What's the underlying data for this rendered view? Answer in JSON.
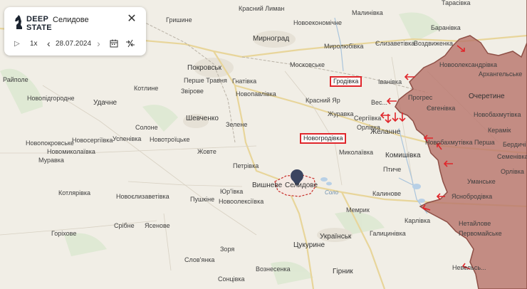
{
  "panel": {
    "logo_line1": "DEEP",
    "logo_line2": "STATE",
    "title": "Селидове",
    "close": "✕",
    "play": "▷",
    "speed": "1x",
    "prev": "‹",
    "date": "28.07.2024",
    "next": "›",
    "calendar_icon": "calendar-icon",
    "compare_icon": "compare-icon"
  },
  "colors": {
    "occupied": "#b8766d",
    "occupied_border": "#8e4f46",
    "arrow": "#e0262b",
    "highlight": "#e0262b",
    "marker": "#3b4560"
  },
  "places": {
    "krasnyi_lyman": "Красний Лиман",
    "malynivka": "Малинівка",
    "tarasivka": "Тарасівка",
    "hryshyne": "Гришине",
    "myrnohrad": "Мирноград",
    "novoekonomichne": "Новоекономічне",
    "baranivka": "Баранівка",
    "myrolyubivka": "Миролюбівка",
    "yelyzavetivka": "Єлизаветівка",
    "vozdvyzhenka": "Воздвиженка",
    "pokrovsk": "Покровськ",
    "moskovske": "Московське",
    "novooleksandrivka": "Новоолександрівка",
    "raipole": "Райполе",
    "pershe_travnia": "Перше Травня",
    "hnativka": "Гнатівка",
    "hrodivka": "Гродівка",
    "ivanivka": "Іванівка",
    "arkhanhelske": "Архангельське",
    "novopidhorodne": "Новопідгородне",
    "kotlyne": "Котлине",
    "zvirove": "Звірове",
    "novopavlivka": "Новопавлівка",
    "prohres": "Прогрес",
    "ocheretyne": "Очеретине",
    "udachne": "Удачне",
    "krasnyi_yar": "Красний Яр",
    "veselyi": "Вес...",
    "yevhenivka": "Євгенівка",
    "shevchenko": "Шевченко",
    "zhuravka": "Журавка",
    "serhiivka": "Сергіївка",
    "novobakhmutivka": "Новобахмутівка",
    "solone": "Солоне",
    "zelene": "Зелене",
    "orlivka_n": "Орлівка",
    "zhelanne": "Желанне",
    "keramik": "Керамік",
    "novoserhiivka": "Новосергіївка",
    "uspenivka": "Успенівка",
    "novotroitske": "Новотроїцьке",
    "novohrodivka": "Новогродівка",
    "novopokrovske": "Новопокровське",
    "novobakhmutivka_pershe": "Новобахмутівка Перша",
    "berdychi": "Бердичі",
    "novomykolaivka": "Новомиколаївка",
    "zhovte": "Жовте",
    "mykolaivka": "Миколаївка",
    "komyshivka": "Комишівка",
    "semenivka": "Семенівка",
    "muravka": "Муравка",
    "petrivka": "Петрівка",
    "ptyche": "Птиче",
    "umanske": "Уманське",
    "orlivka_s": "Орлівка",
    "vyshneve": "Вишневе",
    "selydove_city": "Селидове",
    "solo_river": "Соло",
    "kalynove": "Калинове",
    "yasnobrodivka": "Яснобродівка",
    "kotliarivka": "Котлярівка",
    "novoelyzavetivka": "Новоєлизаветівка",
    "yuriivka": "Юр'ївка",
    "pushkyne": "Пушкіне",
    "novooleksiivka": "Новоолексіївка",
    "memryk": "Мемрик",
    "netailove": "Нетайлове",
    "karlivka": "Карлівка",
    "horikhove": "Горіхове",
    "sribne": "Срібне",
    "yasenove": "Ясенове",
    "ukrainsk": "Українськ",
    "halytsynivka": "Галицинівка",
    "pervomaiske": "Первомайське",
    "zoria": "Зоря",
    "tsukuryne": "Цукурине",
    "slovianka": "Слов'янка",
    "voznesenka": "Вознесенка",
    "hirnyk": "Гірник",
    "sontsivka": "Сонцівка",
    "nevelske": "Невельсь..."
  }
}
